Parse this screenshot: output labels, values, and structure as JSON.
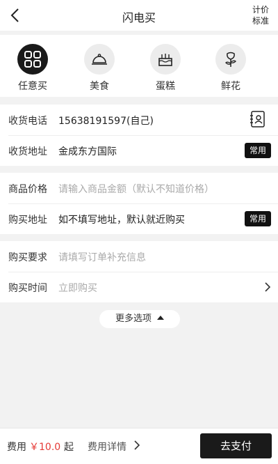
{
  "header": {
    "title": "闪电买",
    "price_std_line1": "计价",
    "price_std_line2": "标准"
  },
  "categories": [
    {
      "label": "任意买",
      "icon": "grid-icon",
      "active": true
    },
    {
      "label": "美食",
      "icon": "food-cloche-icon",
      "active": false
    },
    {
      "label": "蛋糕",
      "icon": "cake-icon",
      "active": false
    },
    {
      "label": "鲜花",
      "icon": "flower-icon",
      "active": false
    }
  ],
  "contact": {
    "phone_label": "收货电话",
    "phone_value": "15638191597(自己)",
    "address_label": "收货地址",
    "address_value": "金成东方国际",
    "common_badge": "常用"
  },
  "goods": {
    "price_label": "商品价格",
    "price_placeholder": "请输入商品金额（默认不知道价格）",
    "buy_addr_label": "购买地址",
    "buy_addr_value": "如不填写地址，默认就近购买",
    "common_badge": "常用"
  },
  "extra": {
    "req_label": "购买要求",
    "req_placeholder": "请填写订单补充信息",
    "time_label": "购买时间",
    "time_value": "立即购买"
  },
  "more_options": "更多选项",
  "footer": {
    "fee_label": "费用",
    "fee_amount": "￥10.0",
    "fee_suffix": "起",
    "fee_detail": "费用详情",
    "pay_button": "去支付"
  },
  "colors": {
    "accent": "#1a1a1a",
    "price": "#e53935",
    "background": "#f2f2f2"
  }
}
